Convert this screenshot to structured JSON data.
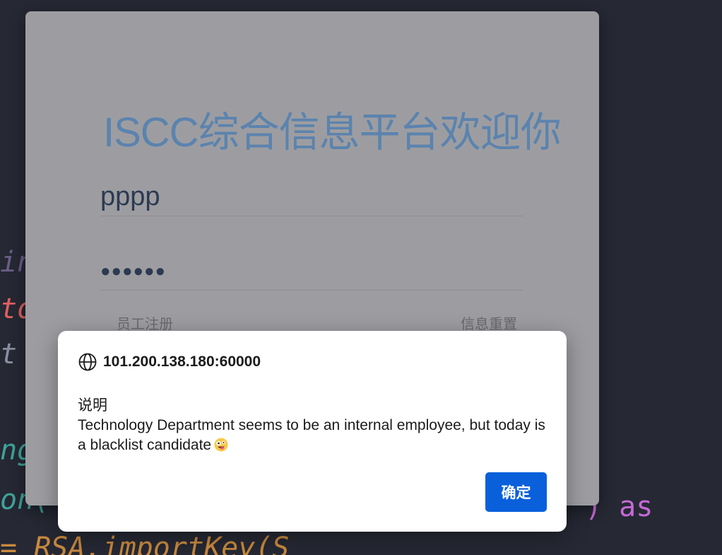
{
  "background_code": {
    "lines": [
      {
        "text": "inj",
        "color": "#6b5f86"
      },
      {
        "text": "to",
        "color": "#e06060"
      },
      {
        "text": "t",
        "color": "#8a8fa0"
      },
      {
        "text": "ng",
        "color": "#3fa39a"
      },
      {
        "text": "on(",
        "color": "#3fa39a"
      },
      {
        "text": ") as",
        "color": "#c56ad6"
      },
      {
        "text": "= RSA.importKey(S",
        "color": "#c98a3e"
      }
    ]
  },
  "login": {
    "title": "ISCC综合信息平台欢迎你",
    "username_value": "pppp",
    "password_mask": "●●●●●●",
    "register_link": "员工注册",
    "reset_link": "信息重置"
  },
  "dialog": {
    "icon": "globe-icon",
    "origin": "101.200.138.180:60000",
    "heading": "说明",
    "message": "Technology Department seems to be an internal employee, but today is a blacklist candidate",
    "emoji": "zany-face-icon",
    "confirm_label": "确定"
  },
  "colors": {
    "title": "#5b83ae",
    "confirm_button": "#0a60db",
    "card": "#9d9da1",
    "background": "#262834"
  }
}
